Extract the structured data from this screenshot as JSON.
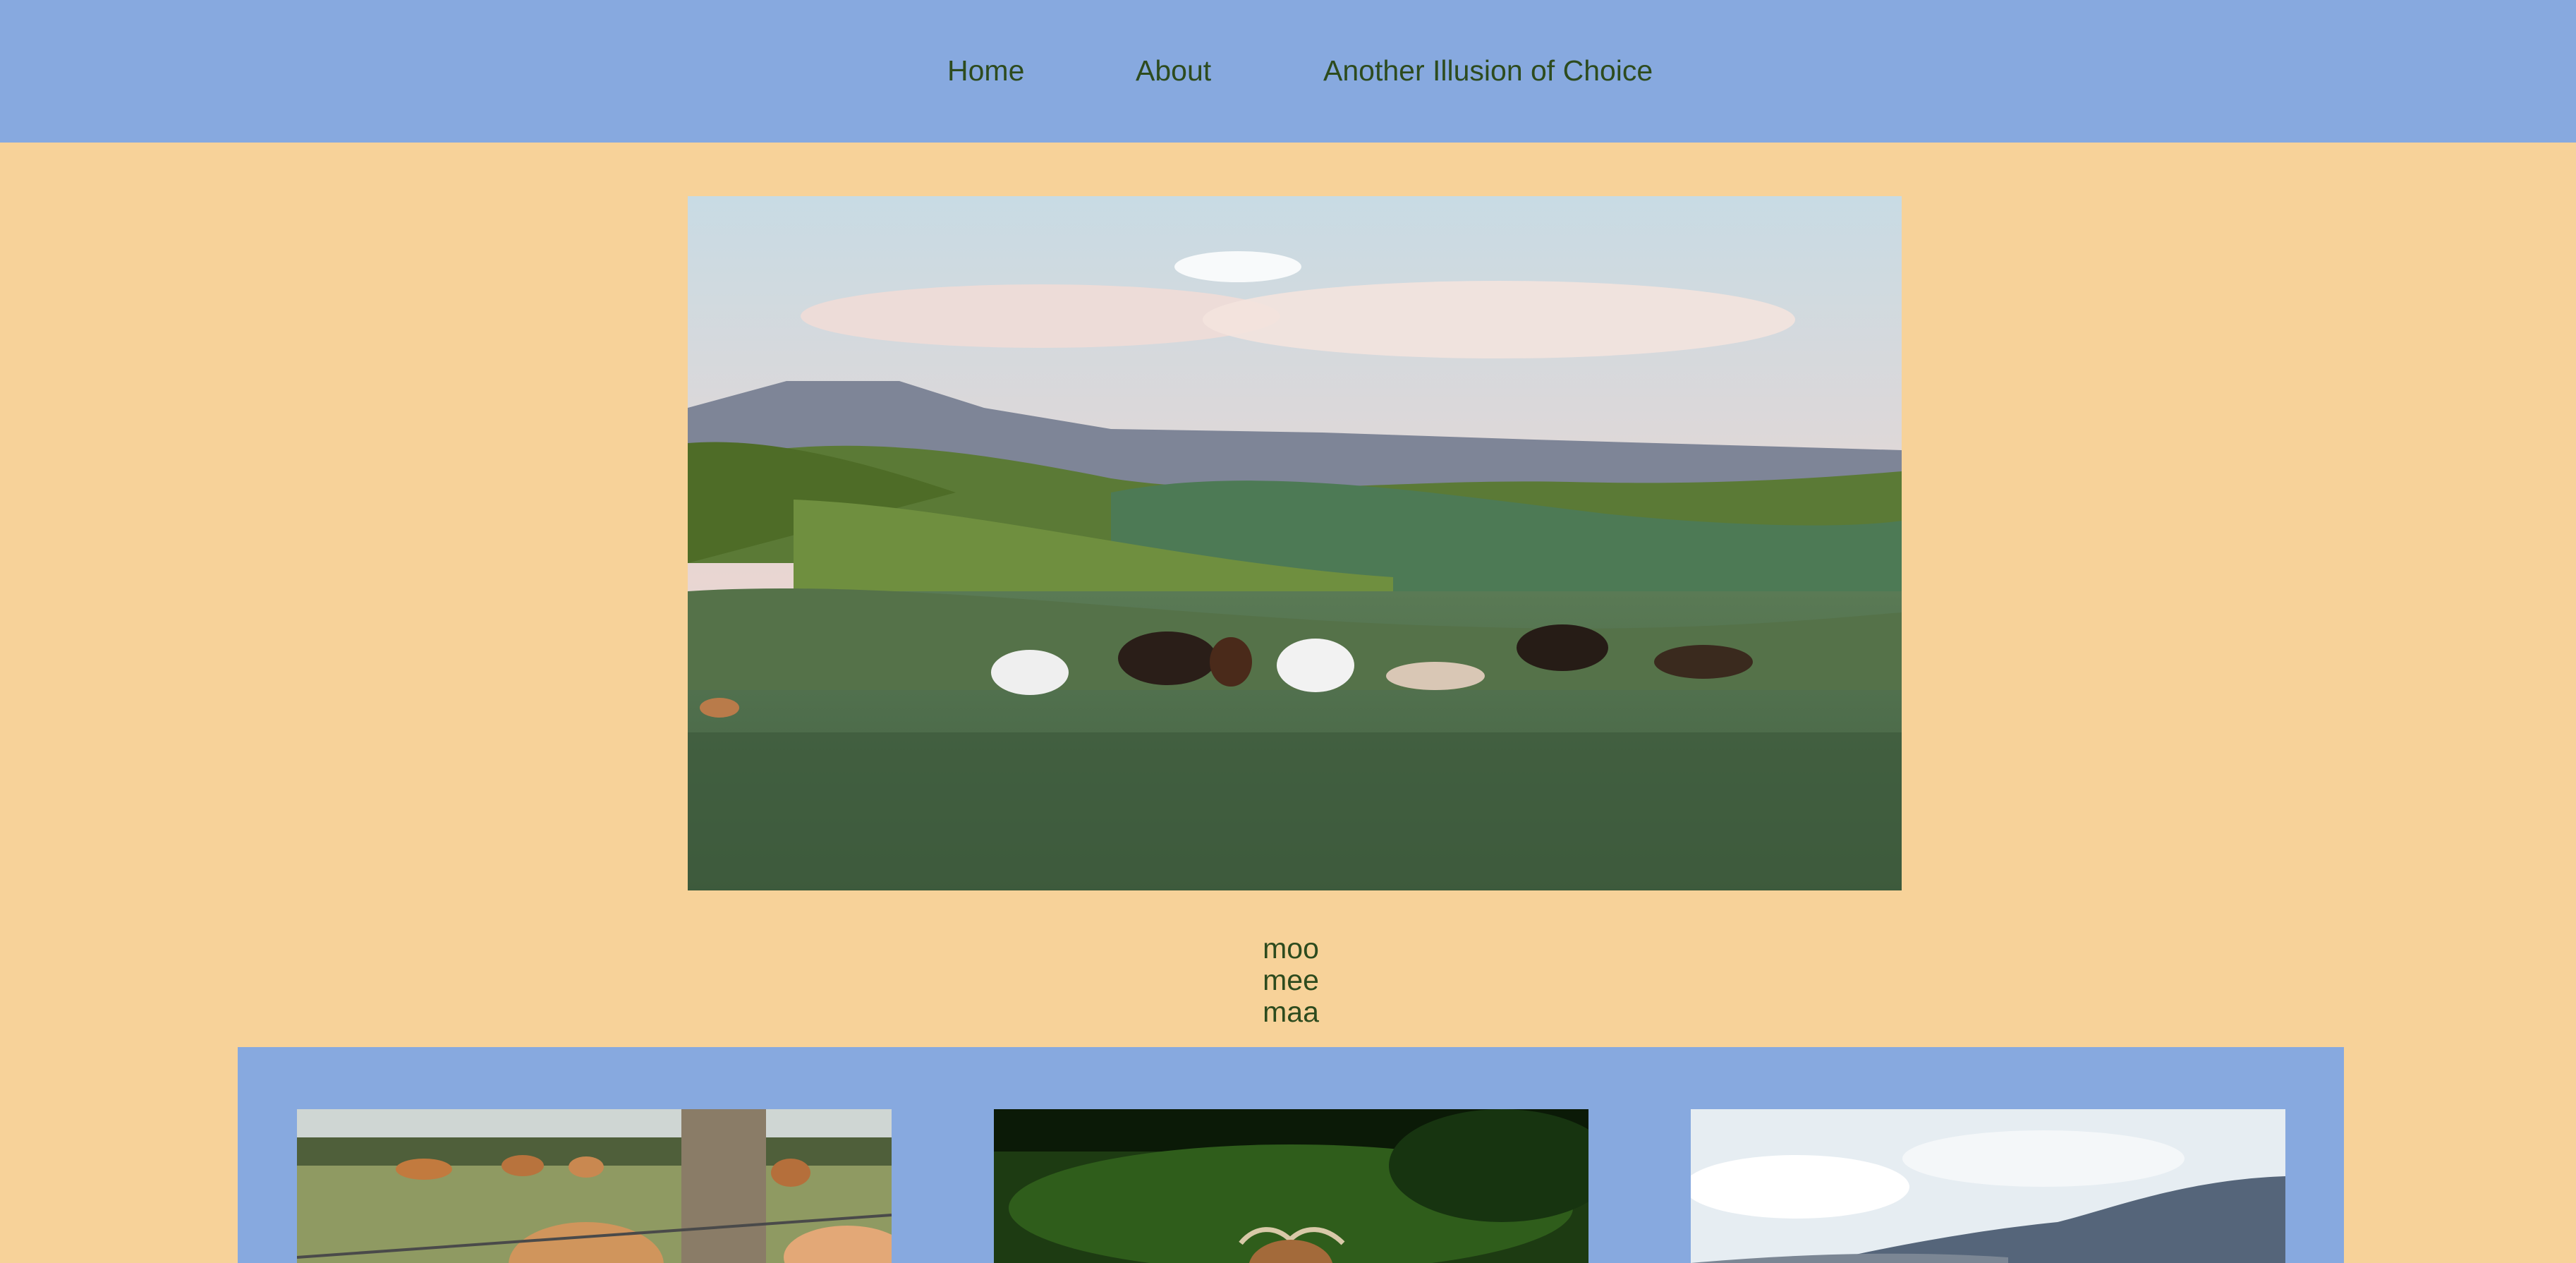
{
  "nav": {
    "items": [
      {
        "label": "Home"
      },
      {
        "label": "About"
      },
      {
        "label": "Another Illusion of Choice"
      }
    ]
  },
  "hero": {
    "image": "cattle-grazing-hills-photo"
  },
  "sounds": {
    "lines": [
      "moo",
      "mee",
      "maa"
    ]
  },
  "gallery": {
    "images": [
      {
        "image": "cows-behind-fence-photo"
      },
      {
        "image": "highland-cow-grass-photo"
      },
      {
        "image": "mountain-sky-photo"
      }
    ]
  },
  "colors": {
    "navbar": "#87a9df",
    "page_background": "#f7d299",
    "text": "#2d4b1e"
  }
}
